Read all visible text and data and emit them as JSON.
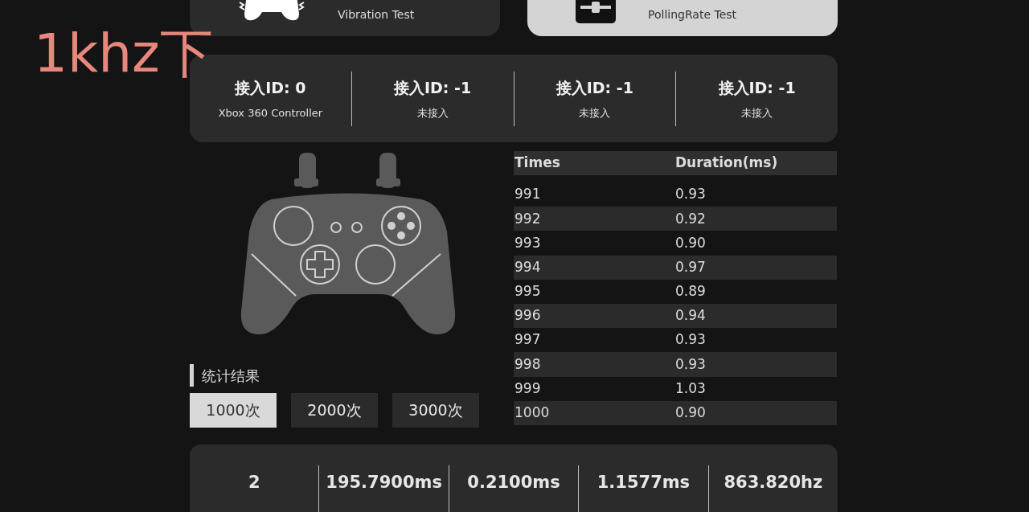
{
  "caption": "1khz下",
  "modes": [
    {
      "label": "Vibration Test",
      "kind": "vibration",
      "selected": false
    },
    {
      "label": "PollingRate Test",
      "kind": "polling",
      "selected": true
    }
  ],
  "devices": [
    {
      "id": "接入ID: 0",
      "name": "Xbox 360 Controller"
    },
    {
      "id": "接入ID: -1",
      "name": "未接入"
    },
    {
      "id": "接入ID: -1",
      "name": "未接入"
    },
    {
      "id": "接入ID: -1",
      "name": "未接入"
    }
  ],
  "table": {
    "columns": [
      "Times",
      "Duration(ms)"
    ],
    "rows": [
      [
        "991",
        "0.93"
      ],
      [
        "992",
        "0.92"
      ],
      [
        "993",
        "0.90"
      ],
      [
        "994",
        "0.97"
      ],
      [
        "995",
        "0.89"
      ],
      [
        "996",
        "0.94"
      ],
      [
        "997",
        "0.93"
      ],
      [
        "998",
        "0.93"
      ],
      [
        "999",
        "1.03"
      ],
      [
        "1000",
        "0.90"
      ]
    ]
  },
  "stats_heading": "统计结果",
  "sample_buttons": [
    {
      "label": "1000次",
      "selected": true
    },
    {
      "label": "2000次",
      "selected": false
    },
    {
      "label": "3000次",
      "selected": false
    }
  ],
  "summary": [
    {
      "value": "2"
    },
    {
      "value": "195.7900ms"
    },
    {
      "value": "0.2100ms"
    },
    {
      "value": "1.1577ms"
    },
    {
      "value": "863.820hz"
    }
  ]
}
